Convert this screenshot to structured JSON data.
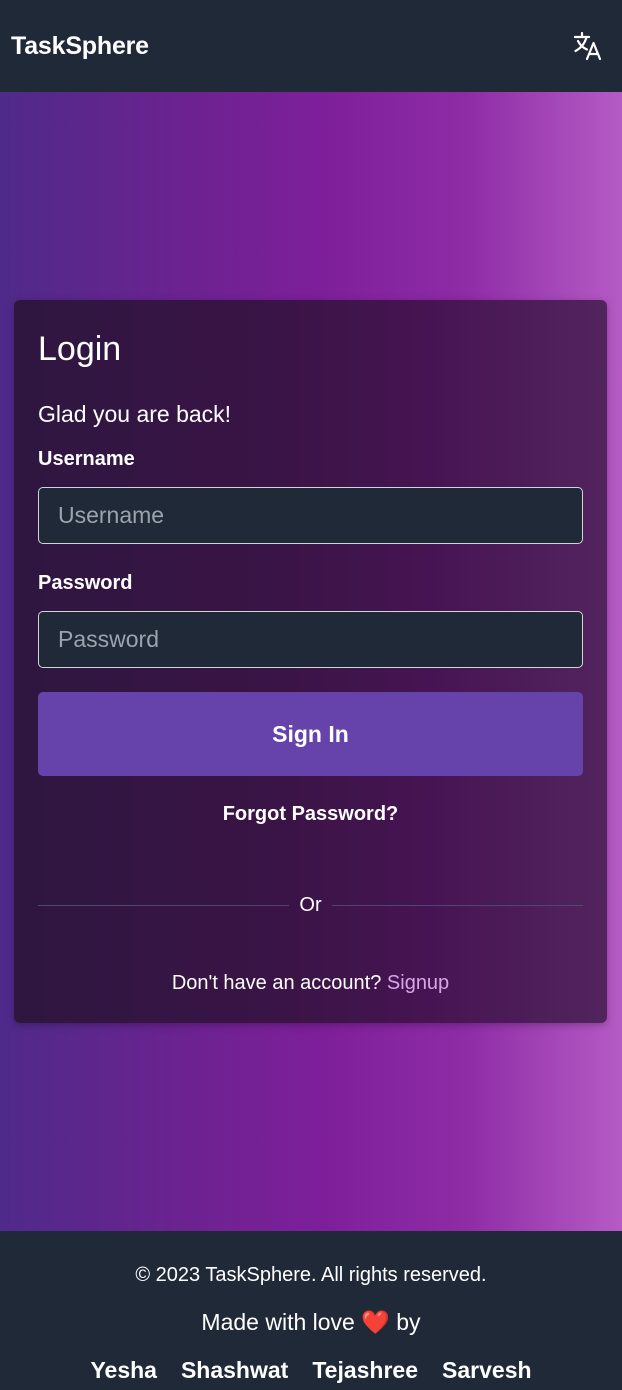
{
  "navbar": {
    "brand": "TaskSphere",
    "translate_icon": "translate-icon"
  },
  "login": {
    "title": "Login",
    "subtitle": "Glad you are back!",
    "username_label": "Username",
    "username_placeholder": "Username",
    "username_value": "",
    "password_label": "Password",
    "password_placeholder": "Password",
    "password_value": "",
    "signin_label": "Sign In",
    "forgot_label": "Forgot Password?",
    "divider_text": "Or",
    "signup_prompt": "Don't have an account?",
    "signup_link": "Signup"
  },
  "footer": {
    "copyright": "© 2023 TaskSphere. All rights reserved.",
    "made_with_prefix": "Made with love",
    "heart": "❤️",
    "made_with_suffix": "by",
    "authors": [
      "Yesha",
      "Shashwat",
      "Tejashree",
      "Sarvesh"
    ]
  },
  "colors": {
    "navbar_bg": "#1f2937",
    "button_bg": "#6643ab",
    "link_color": "#d6a6e8",
    "input_bg": "#1f2937"
  }
}
